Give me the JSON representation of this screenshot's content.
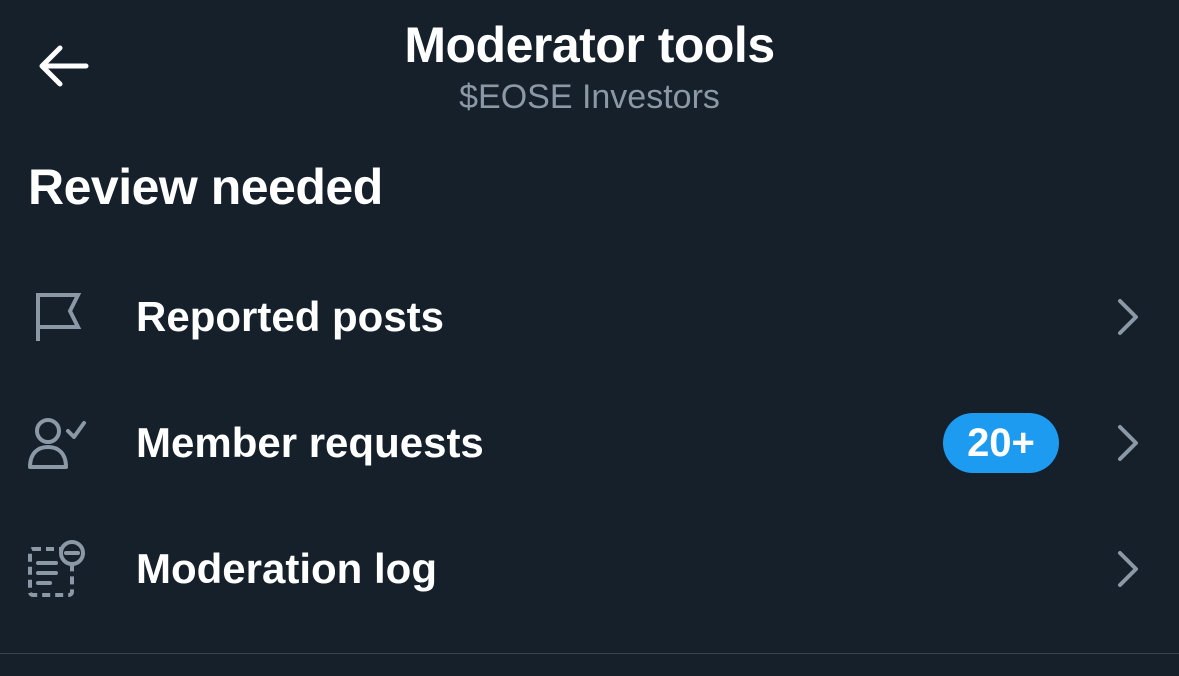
{
  "header": {
    "title": "Moderator tools",
    "subtitle": "$EOSE Investors",
    "back_icon": "arrow-left-icon"
  },
  "section": {
    "title": "Review needed"
  },
  "items": [
    {
      "label": "Reported posts",
      "icon": "flag-icon",
      "badge": ""
    },
    {
      "label": "Member requests",
      "icon": "person-check-icon",
      "badge": "20+"
    },
    {
      "label": "Moderation log",
      "icon": "log-remove-icon",
      "badge": ""
    }
  ],
  "colors": {
    "background": "#15202b",
    "primary_text": "#ffffff",
    "secondary_text": "#8b98a5",
    "accent": "#1d9bf0",
    "chevron": "#8b98a5"
  }
}
